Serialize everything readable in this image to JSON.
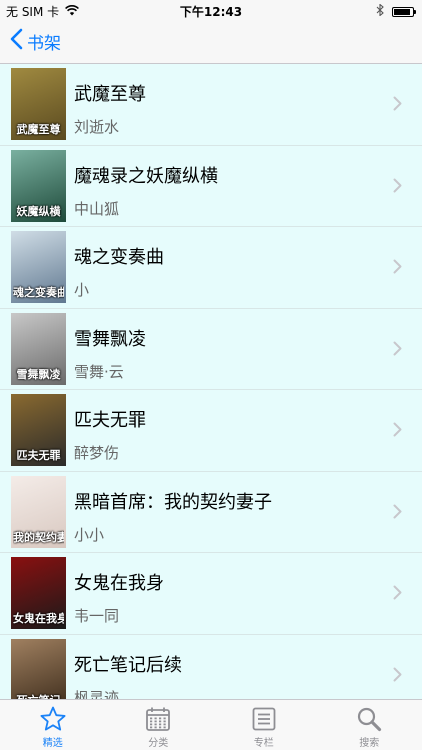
{
  "status_bar": {
    "carrier": "无 SIM 卡",
    "time": "下午12:43",
    "battery_level": 0.9
  },
  "nav": {
    "back_label": "书架"
  },
  "books": [
    {
      "title": "武魔至尊",
      "author": "刘逝水",
      "cover_text": "武魔至尊"
    },
    {
      "title": "魔魂录之妖魔纵横",
      "author": "中山狐",
      "cover_text": "妖魔纵横"
    },
    {
      "title": "魂之变奏曲",
      "author": "小",
      "cover_text": "魂之变奏曲"
    },
    {
      "title": "雪舞飘凌",
      "author": "雪舞·云",
      "cover_text": "雪舞飘凌"
    },
    {
      "title": "匹夫无罪",
      "author": "醉梦伤",
      "cover_text": "匹夫无罪"
    },
    {
      "title": "黑暗首席：我的契约妻子",
      "author": "小小",
      "cover_text": "我的契约妻子"
    },
    {
      "title": "女鬼在我身",
      "author": "韦一同",
      "cover_text": "女鬼在我身"
    },
    {
      "title": "死亡笔记后续",
      "author": "枫灵迹",
      "cover_text": "死亡笔记"
    }
  ],
  "cover_colors": [
    [
      "#5a4a20",
      "#a08a40"
    ],
    [
      "#1e4a3a",
      "#7ab0a0"
    ],
    [
      "#607890",
      "#d0dde6"
    ],
    [
      "#6a6a6a",
      "#c8c8c8"
    ],
    [
      "#2a2a2a",
      "#8a6a30"
    ],
    [
      "#d8c8c0",
      "#f4ece8"
    ],
    [
      "#1a1a1a",
      "#8a1010"
    ],
    [
      "#3a2a1a",
      "#a08060"
    ]
  ],
  "tabs": [
    {
      "label": "精选",
      "icon": "star-icon",
      "active": true
    },
    {
      "label": "分类",
      "icon": "calendar-icon",
      "active": false
    },
    {
      "label": "专栏",
      "icon": "list-icon",
      "active": false
    },
    {
      "label": "搜索",
      "icon": "search-icon",
      "active": false
    }
  ],
  "colors": {
    "accent": "#0a7cff",
    "list_background": "#e6fcfc",
    "tab_inactive": "#8e8e93"
  }
}
